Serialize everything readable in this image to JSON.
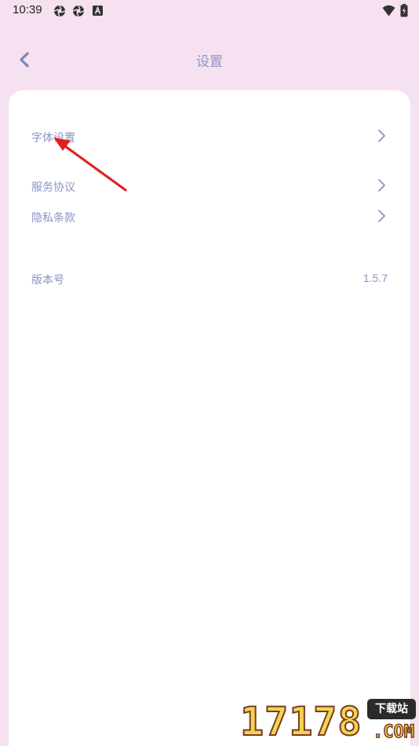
{
  "status_bar": {
    "time": "10:39",
    "left_icons": [
      "aperture-icon",
      "aperture-icon",
      "android-a-icon"
    ],
    "right_icons": [
      "wifi-icon",
      "battery-charging-icon"
    ]
  },
  "header": {
    "title": "设置",
    "back_icon": "chevron-left-icon"
  },
  "settings": {
    "items": [
      {
        "label": "字体设置",
        "action": "chevron-right-icon"
      },
      {
        "label": "服务协议",
        "action": "chevron-right-icon"
      },
      {
        "label": "隐私条款",
        "action": "chevron-right-icon"
      }
    ],
    "version": {
      "label": "版本号",
      "value": "1.5.7"
    }
  },
  "annotation": {
    "type": "red-arrow",
    "color": "#e02020"
  },
  "watermark": {
    "digits": "17178",
    "tag": "下载站",
    "suffix": ".COM"
  },
  "colors": {
    "background": "#f5e1ef",
    "card": "#ffffff",
    "text_accent": "#8b93c3",
    "arrow": "#e02020"
  }
}
